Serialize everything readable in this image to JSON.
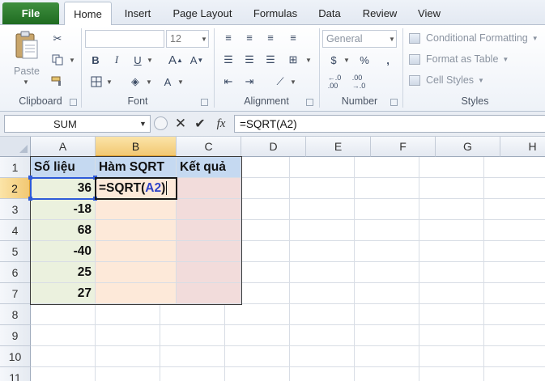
{
  "tabs": {
    "file": "File",
    "items": [
      "Home",
      "Insert",
      "Page Layout",
      "Formulas",
      "Data",
      "Review",
      "View"
    ]
  },
  "ribbon": {
    "clipboard": {
      "label": "Clipboard",
      "paste": "Paste"
    },
    "font": {
      "label": "Font",
      "size": "12"
    },
    "alignment": {
      "label": "Alignment"
    },
    "number": {
      "label": "Number",
      "format": "General",
      "currency": "$",
      "percent": "%",
      "comma": ","
    },
    "styles": {
      "label": "Styles",
      "conditional": "Conditional Formatting",
      "format_table": "Format as Table",
      "cell_styles": "Cell Styles"
    }
  },
  "formula_bar": {
    "name_box": "SUM",
    "fx": "fx",
    "formula": "=SQRT(A2)"
  },
  "sheet": {
    "columns": [
      "A",
      "B",
      "C",
      "D",
      "E",
      "F",
      "G",
      "H"
    ],
    "rows": [
      "1",
      "2",
      "3",
      "4",
      "5",
      "6",
      "7",
      "8",
      "9",
      "10",
      "11"
    ],
    "headers": {
      "a": "Số liệu",
      "b": "Hàm SQRT",
      "c": "Kết quả"
    },
    "values": [
      "36",
      "-18",
      "68",
      "-40",
      "25",
      "27"
    ],
    "edit_prefix": "=SQRT(",
    "edit_ref": "A2",
    "edit_suffix": ")"
  },
  "colors": {
    "accent_green": "#1f6b21",
    "col_a_fill": "#ebf1de",
    "col_b_fill": "#fde9d9",
    "col_c_fill": "#f2dcdb",
    "header_fill": "#c5d9f1",
    "ref_blue": "#2f5bd8"
  }
}
